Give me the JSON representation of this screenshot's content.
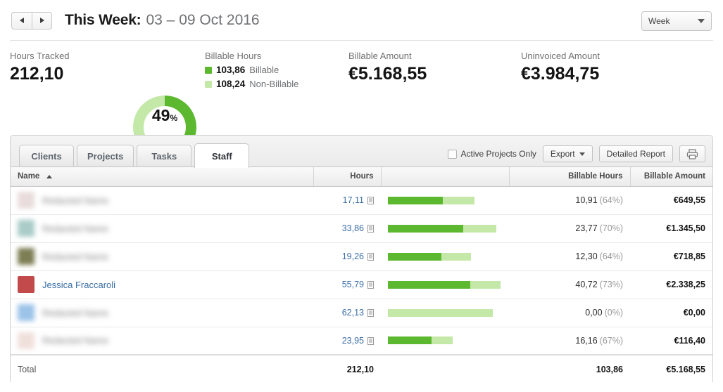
{
  "header": {
    "prev_icon": "triangle-left-icon",
    "next_icon": "triangle-right-icon",
    "title_main": "This Week:",
    "title_range": "03 – 09 Oct 2016",
    "period_select": "Week"
  },
  "summary": {
    "hours_tracked_label": "Hours Tracked",
    "hours_tracked_value": "212,10",
    "donut_value": "49",
    "donut_unit": "%",
    "billable_hours_label": "Billable Hours",
    "billable_value": "103,86",
    "billable_legend": "Billable",
    "nonbillable_value": "108,24",
    "nonbillable_legend": "Non-Billable",
    "billable_amount_label": "Billable Amount",
    "billable_amount_value": "€5.168,55",
    "uninvoiced_amount_label": "Uninvoiced Amount",
    "uninvoiced_amount_value": "€3.984,75"
  },
  "colors": {
    "billable": "#5cb82e",
    "non_billable": "#c4e8a8",
    "link": "#3a6ea5"
  },
  "tabs": [
    {
      "label": "Clients",
      "active": false
    },
    {
      "label": "Projects",
      "active": false
    },
    {
      "label": "Tasks",
      "active": false
    },
    {
      "label": "Staff",
      "active": true
    }
  ],
  "toolbar": {
    "active_projects_only": "Active Projects Only",
    "export": "Export",
    "detailed_report": "Detailed Report",
    "print_icon": "printer-icon"
  },
  "table": {
    "columns": {
      "name": "Name",
      "hours": "Hours",
      "bar": "",
      "billable_hours": "Billable Hours",
      "billable_amount": "Billable Amount"
    },
    "sort": "asc",
    "rows": [
      {
        "name": "",
        "blurred": true,
        "avatar_color": "#e9dcdc",
        "hours": "17,11",
        "billable_pct_width": 48,
        "nonbillable_pct_width": 28,
        "billable_hours": "10,91",
        "pct": "(64%)",
        "amount": "€649,55"
      },
      {
        "name": "",
        "blurred": true,
        "avatar_color": "#a9ccc8",
        "hours": "33,86",
        "billable_pct_width": 66,
        "nonbillable_pct_width": 29,
        "billable_hours": "23,77",
        "pct": "(70%)",
        "amount": "€1.345,50"
      },
      {
        "name": "",
        "blurred": true,
        "avatar_color": "#7d7e54",
        "hours": "19,26",
        "billable_pct_width": 47,
        "nonbillable_pct_width": 26,
        "billable_hours": "12,30",
        "pct": "(64%)",
        "amount": "€718,85"
      },
      {
        "name": "Jessica Fraccaroli",
        "blurred": false,
        "avatar_color": "#c24a4a",
        "hours": "55,79",
        "billable_pct_width": 72,
        "nonbillable_pct_width": 27,
        "billable_hours": "40,72",
        "pct": "(73%)",
        "amount": "€2.338,25"
      },
      {
        "name": "",
        "blurred": true,
        "avatar_color": "#9cc3e8",
        "hours": "62,13",
        "billable_pct_width": 0,
        "nonbillable_pct_width": 92,
        "billable_hours": "0,00",
        "pct": "(0%)",
        "amount": "€0,00"
      },
      {
        "name": "",
        "blurred": true,
        "avatar_color": "#f0e0dc",
        "hours": "23,95",
        "billable_pct_width": 38,
        "nonbillable_pct_width": 19,
        "billable_hours": "16,16",
        "pct": "(67%)",
        "amount": "€116,40"
      }
    ],
    "total": {
      "label": "Total",
      "hours": "212,10",
      "billable_hours": "103,86",
      "amount": "€5.168,55"
    }
  }
}
